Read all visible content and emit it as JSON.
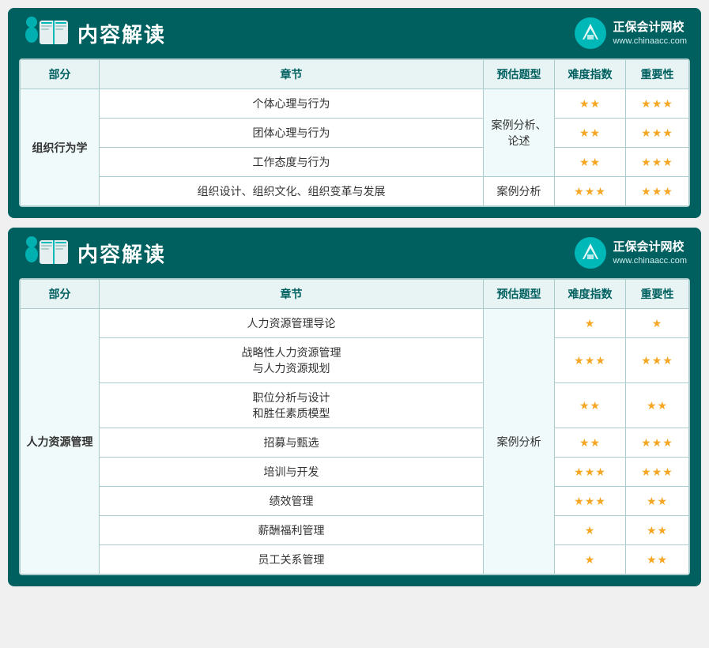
{
  "cards": [
    {
      "id": "card1",
      "title": "内容解读",
      "logo_name": "正保会计网校",
      "logo_url": "www.chinaacc.com",
      "table": {
        "headers": [
          "部分",
          "章节",
          "预估题型",
          "难度指数",
          "重要性"
        ],
        "rows": [
          {
            "part": "组织行为学",
            "part_rowspan": 4,
            "chapters": [
              {
                "chapter": "个体心理与行为",
                "type": "案例分析、\n论述",
                "type_rowspan": 3,
                "diff": "★★",
                "imp": "★★★"
              },
              {
                "chapter": "团体心理与行为",
                "type": null,
                "diff": "★★",
                "imp": "★★★"
              },
              {
                "chapter": "工作态度与行为",
                "type": null,
                "diff": "★★",
                "imp": "★★★"
              },
              {
                "chapter": "组织设计、组织文化、组织变革与发展",
                "type": "案例分析",
                "type_rowspan": 1,
                "diff": "★★★",
                "imp": "★★★"
              }
            ]
          }
        ]
      }
    },
    {
      "id": "card2",
      "title": "内容解读",
      "logo_name": "正保会计网校",
      "logo_url": "www.chinaacc.com",
      "table": {
        "headers": [
          "部分",
          "章节",
          "预估题型",
          "难度指数",
          "重要性"
        ],
        "rows": [
          {
            "part": "人力资源管理",
            "part_rowspan": 8,
            "chapters": [
              {
                "chapter": "人力资源管理导论",
                "type": "案例分析",
                "type_rowspan": 8,
                "diff": "★",
                "imp": "★"
              },
              {
                "chapter": "战略性人力资源管理\n与人力资源规划",
                "type": null,
                "diff": "★★★",
                "imp": "★★★"
              },
              {
                "chapter": "职位分析与设计\n和胜任素质模型",
                "type": null,
                "diff": "★★",
                "imp": "★★"
              },
              {
                "chapter": "招募与甄选",
                "type": null,
                "diff": "★★",
                "imp": "★★★"
              },
              {
                "chapter": "培训与开发",
                "type": null,
                "diff": "★★★",
                "imp": "★★★"
              },
              {
                "chapter": "绩效管理",
                "type": null,
                "diff": "★★★",
                "imp": "★★"
              },
              {
                "chapter": "薪酬福利管理",
                "type": null,
                "diff": "★",
                "imp": "★★"
              },
              {
                "chapter": "员工关系管理",
                "type": null,
                "diff": "★",
                "imp": "★★"
              }
            ]
          }
        ]
      }
    }
  ]
}
